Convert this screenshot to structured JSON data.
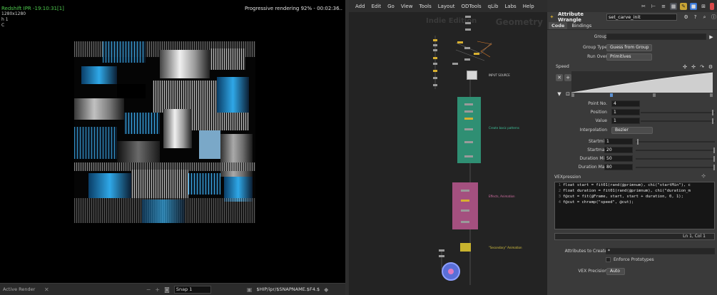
{
  "render_view": {
    "title": "Redshift IPR -19:10:31[1]",
    "resolution": "1280x1280",
    "line2": "h 1",
    "line3": "C",
    "status": "Progressive rendering 92% - 00:02:36..",
    "bottom_tab": "Active Render",
    "snap_label": "Snap 1",
    "snap_path": "$HIP/ipr/$SNAPNAME.$F4.$"
  },
  "network_editor": {
    "menu": [
      "Add",
      "Edit",
      "Go",
      "View",
      "Tools",
      "Layout",
      "ODTools",
      "qLib",
      "Labs",
      "Help"
    ],
    "watermark_left": "Indie Edition",
    "watermark_right": "Geometry",
    "boxes": [
      {
        "label": "INPUT SOURCE",
        "color": "#d6d6d6"
      },
      {
        "label": "Create basic patterns",
        "color": "#2f8f73"
      },
      {
        "label": "Effects, Animation",
        "color": "#a4507f"
      },
      {
        "label": "\"Secondary\" Animation",
        "color": "#c8b32e"
      }
    ]
  },
  "parameters": {
    "node_type": "Attribute Wrangle",
    "node_name": "set_carve_init",
    "tabs": [
      "Code",
      "Bindings"
    ],
    "active_tab": "Code",
    "group_label": "Group",
    "group_value": "",
    "group_type_label": "Group Type",
    "group_type_value": "Guess from Group",
    "run_over_label": "Run Over",
    "run_over_value": "Primitives",
    "ramp_label": "Speed",
    "point_no_label": "Point No.",
    "point_no_value": "4",
    "position_label": "Position",
    "position_value": "1",
    "value_label": "Value",
    "value_value": "1",
    "interp_label": "Interpolation",
    "interp_value": "Bezier",
    "startmin_label": "Startmin",
    "startmin_value": "1",
    "startmax_label": "Startmax",
    "startmax_value": "20",
    "durmin_label": "Duration Min",
    "durmin_value": "50",
    "durmax_label": "Duration Max",
    "durmax_value": "80",
    "vex_label": "VEXpression",
    "vex_lines": [
      {
        "n": "1",
        "code": "float start = fit01(rand(@primnum), chi(\"startMin\"), c"
      },
      {
        "n": "2",
        "code": "float duration = fit01(rand(@primnum), chi(\"duration_m"
      },
      {
        "n": "3",
        "code": "f@cut = fit(@Frame, start, start + duration, 0, 1);"
      },
      {
        "n": "4",
        "code": "f@cut = chramp(\"speed\", @cut);"
      }
    ],
    "cursor_pos": "Ln 1, Col 1",
    "attr_create_label": "Attributes to Create",
    "attr_create_value": "*",
    "enforce_label": "Enforce Prototypes",
    "vex_precision_label": "VEX Precision",
    "vex_precision_value": "Auto"
  }
}
